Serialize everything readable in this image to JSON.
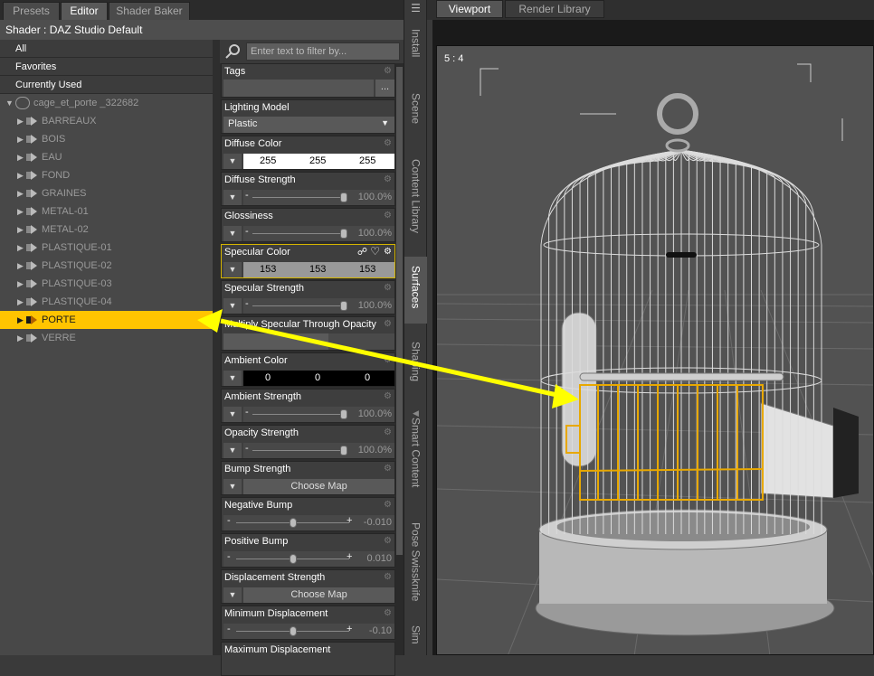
{
  "top_tabs": [
    "Presets",
    "Editor",
    "Shader Baker"
  ],
  "shader_title": "Shader : DAZ Studio Default",
  "categories": [
    "All",
    "Favorites",
    "Currently Used"
  ],
  "tree": {
    "root": "cage_et_porte _322682",
    "items": [
      "BARREAUX",
      "BOIS",
      "EAU",
      "FOND",
      "GRAINES",
      "METAL-01",
      "METAL-02",
      "PLASTIQUE-01",
      "PLASTIQUE-02",
      "PLASTIQUE-03",
      "PLASTIQUE-04",
      "PORTE",
      "VERRE"
    ],
    "selected": "PORTE"
  },
  "filter": {
    "placeholder": "Enter text to filter by..."
  },
  "properties": {
    "tags": {
      "label": "Tags",
      "button": "..."
    },
    "lighting_model": {
      "label": "Lighting Model",
      "value": "Plastic"
    },
    "diffuse_color": {
      "label": "Diffuse Color",
      "r": "255",
      "g": "255",
      "b": "255"
    },
    "diffuse_strength": {
      "label": "Diffuse Strength",
      "value": "100.0%",
      "level": 1.0
    },
    "glossiness": {
      "label": "Glossiness",
      "value": "100.0%",
      "level": 1.0
    },
    "specular_color": {
      "label": "Specular Color",
      "r": "153",
      "g": "153",
      "b": "153"
    },
    "specular_strength": {
      "label": "Specular Strength",
      "value": "100.0%",
      "level": 1.0
    },
    "multiply_specular": {
      "label": "Multiply Specular Through Opacity"
    },
    "ambient_color": {
      "label": "Ambient Color",
      "r": "0",
      "g": "0",
      "b": "0"
    },
    "ambient_strength": {
      "label": "Ambient Strength",
      "value": "100.0%",
      "level": 1.0
    },
    "opacity_strength": {
      "label": "Opacity Strength",
      "value": "100.0%",
      "level": 1.0
    },
    "bump_strength": {
      "label": "Bump Strength",
      "button": "Choose Map"
    },
    "negative_bump": {
      "label": "Negative Bump",
      "value": "-0.010",
      "level": 0.5
    },
    "positive_bump": {
      "label": "Positive Bump",
      "value": "0.010",
      "level": 0.5
    },
    "displacement_strength": {
      "label": "Displacement Strength",
      "button": "Choose Map"
    },
    "minimum_displacement": {
      "label": "Minimum Displacement",
      "value": "-0.10",
      "level": 0.5
    },
    "maximum_displacement": {
      "label": "Maximum Displacement"
    }
  },
  "side_tabs": [
    "Install",
    "Scene",
    "Content Library",
    "Surfaces",
    "Shaping",
    "Smart Content",
    "Pose Swissknife",
    "Sim"
  ],
  "viewport_tabs": [
    "Viewport",
    "Render Library"
  ],
  "viewport": {
    "aspect_label": "5 : 4"
  },
  "colors": {
    "selection": "#ffc400",
    "arrow": "#ffff00",
    "highlight": "#e8a800"
  }
}
